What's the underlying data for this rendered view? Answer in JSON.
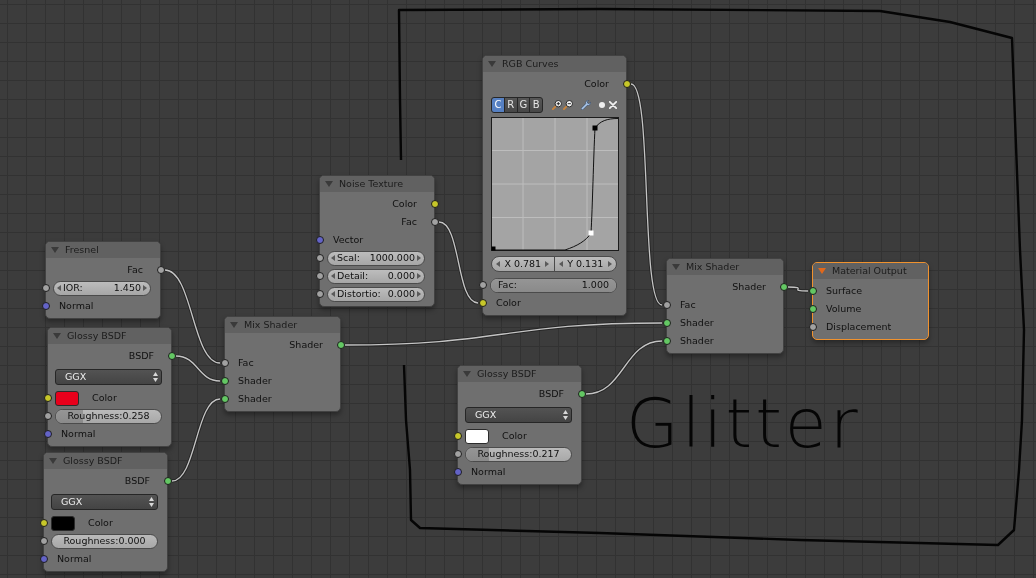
{
  "nodes": [
    {
      "title": "Fresnel",
      "selected": false,
      "outputs": [
        {
          "label": "Fac",
          "color": "#a1a1a1"
        }
      ],
      "inputs": [
        {
          "kind": "number",
          "label": "IOR:",
          "value": "1.450",
          "color": "#a1a1a1"
        },
        {
          "kind": "socket",
          "label": "Normal",
          "color": "#6363c7"
        }
      ]
    },
    {
      "title": "Glossy BSDF",
      "selected": false,
      "outputs": [
        {
          "label": "BSDF",
          "color": "#63c763"
        }
      ],
      "inputs": [
        {
          "kind": "dropdown",
          "value": "GGX"
        },
        {
          "kind": "color",
          "label": "Color",
          "color": "#c7c729",
          "swatch": {
            "color": "#e8001b"
          }
        },
        {
          "kind": "slider",
          "label": "Roughness:",
          "value": "0.258",
          "level": 0.258,
          "color": "#a1a1a1"
        },
        {
          "kind": "socket",
          "label": "Normal",
          "color": "#6363c7"
        }
      ]
    },
    {
      "title": "Glossy BSDF",
      "selected": false,
      "outputs": [
        {
          "label": "BSDF",
          "color": "#63c763"
        }
      ],
      "inputs": [
        {
          "kind": "dropdown",
          "value": "GGX"
        },
        {
          "kind": "color",
          "label": "Color",
          "color": "#c7c729",
          "swatch": {
            "color": "#000000"
          }
        },
        {
          "kind": "slider",
          "label": "Roughness:",
          "value": "0.000",
          "color": "#a1a1a1"
        },
        {
          "kind": "socket",
          "label": "Normal",
          "color": "#6363c7"
        }
      ]
    },
    {
      "title": "Mix Shader",
      "selected": false,
      "outputs": [
        {
          "label": "Shader",
          "color": "#63c763"
        }
      ],
      "inputs": [
        {
          "kind": "socket",
          "label": "Fac",
          "color": "#a1a1a1"
        },
        {
          "kind": "socket",
          "label": "Shader",
          "color": "#63c763"
        },
        {
          "kind": "socket",
          "label": "Shader",
          "color": "#63c763"
        }
      ]
    },
    {
      "title": "Noise Texture",
      "selected": false,
      "outputs": [
        {
          "label": "Color",
          "color": "#c7c729"
        },
        {
          "label": "Fac",
          "color": "#a1a1a1"
        }
      ],
      "inputs": [
        {
          "kind": "socket",
          "label": "Vector",
          "color": "#6363c7"
        },
        {
          "kind": "number",
          "label": "Scal:",
          "value": "1000.000",
          "color": "#a1a1a1"
        },
        {
          "kind": "number",
          "label": "Detail:",
          "value": "0.000",
          "color": "#a1a1a1"
        },
        {
          "kind": "number",
          "label": "Distortio:",
          "value": "0.000",
          "color": "#a1a1a1"
        }
      ]
    },
    {
      "title": "RGB Curves",
      "selected": false,
      "outputs": [
        {
          "label": "Color",
          "color": "#c7c729"
        }
      ],
      "inputs": [
        {
          "kind": "curve",
          "channels": [
            {
              "label": "C",
              "selected": true
            },
            {
              "label": "R",
              "selected": false
            },
            {
              "label": "G",
              "selected": false
            },
            {
              "label": "B",
              "selected": false
            }
          ],
          "point_x": "X 0.781",
          "point_y": "Y 0.131"
        },
        {
          "kind": "slider",
          "label": "Fac:",
          "value": "1.000",
          "level": 1,
          "color": "#a1a1a1"
        },
        {
          "kind": "socket",
          "label": "Color",
          "color": "#c7c729"
        }
      ]
    },
    {
      "title": "Mix Shader",
      "selected": false,
      "outputs": [
        {
          "label": "Shader",
          "color": "#63c763"
        }
      ],
      "inputs": [
        {
          "kind": "socket",
          "label": "Fac",
          "color": "#a1a1a1"
        },
        {
          "kind": "socket",
          "label": "Shader",
          "color": "#63c763"
        },
        {
          "kind": "socket",
          "label": "Shader",
          "color": "#63c763"
        }
      ]
    },
    {
      "title": "Material Output",
      "selected": true,
      "inputs": [
        {
          "kind": "socket",
          "label": "Surface",
          "color": "#63c763"
        },
        {
          "kind": "socket",
          "label": "Volume",
          "color": "#63c763"
        },
        {
          "kind": "socket",
          "label": "Displacement",
          "color": "#a1a1a1"
        }
      ]
    },
    {
      "title": "Glossy BSDF",
      "selected": false,
      "outputs": [
        {
          "label": "BSDF",
          "color": "#63c763"
        }
      ],
      "inputs": [
        {
          "kind": "dropdown",
          "value": "GGX"
        },
        {
          "kind": "color",
          "label": "Color",
          "color": "#c7c729",
          "swatch": {
            "color": "#ffffff"
          }
        },
        {
          "kind": "slider",
          "label": "Roughness:",
          "value": "0.217",
          "level": 0.217,
          "color": "#a1a1a1"
        },
        {
          "kind": "socket",
          "label": "Normal",
          "color": "#6363c7"
        }
      ]
    }
  ],
  "annotation": {
    "text": "Glitter"
  }
}
